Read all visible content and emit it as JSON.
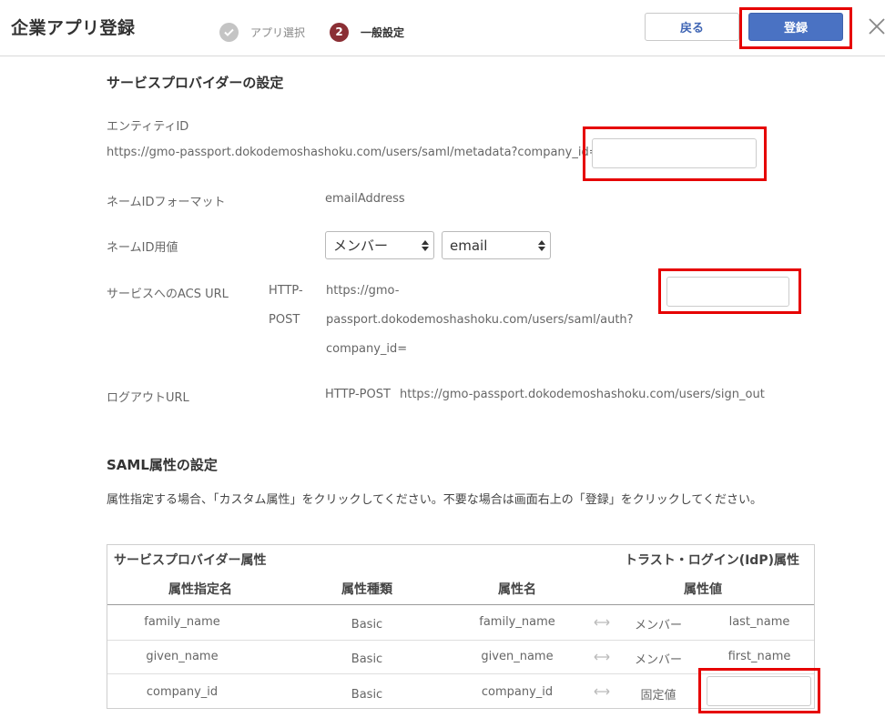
{
  "header": {
    "title": "企業アプリ登録",
    "steps": [
      {
        "label": "アプリ選択",
        "icon": "check-icon"
      },
      {
        "label": "一般設定",
        "number": "2"
      }
    ],
    "back_label": "戻る",
    "register_label": "登録",
    "close_icon": "close-icon"
  },
  "sp_settings": {
    "title": "サービスプロバイダーの設定",
    "entity_id": {
      "label": "エンティティID",
      "url": "https://gmo-passport.dokodemoshashoku.com/users/saml/metadata?company_id=",
      "input_value": ""
    },
    "name_id_format": {
      "label": "ネームIDフォーマット",
      "value": "emailAddress"
    },
    "name_id_value": {
      "label": "ネームID用値",
      "select1": "メンバー",
      "select2": "email"
    },
    "acs_url": {
      "label": "サービスへのACS URL",
      "binding_line1": "HTTP-",
      "binding_line2": "POST",
      "url_line1": "https://gmo-",
      "url_line2": "passport.dokodemoshashoku.com/users/saml/auth?",
      "url_line3": "company_id=",
      "input_value": ""
    },
    "logout_url": {
      "label": "ログアウトURL",
      "binding": "HTTP-POST",
      "url": "https://gmo-passport.dokodemoshashoku.com/users/sign_out"
    }
  },
  "saml_settings": {
    "title": "SAML属性の設定",
    "description": "属性指定する場合、「カスタム属性」をクリックしてください。不要な場合は画面右上の「登録」をクリックしてください。",
    "table": {
      "group_left": "サービスプロバイダー属性",
      "group_right": "トラスト・ログイン(IdP)属性",
      "columns": [
        "属性指定名",
        "属性種類",
        "属性名",
        "属性値"
      ],
      "rows": [
        {
          "attr_name": "family_name",
          "type": "Basic",
          "idp_attr": "family_name",
          "idp_type": "メンバー",
          "value": "last_name"
        },
        {
          "attr_name": "given_name",
          "type": "Basic",
          "idp_attr": "given_name",
          "idp_type": "メンバー",
          "value": "first_name"
        },
        {
          "attr_name": "company_id",
          "type": "Basic",
          "idp_attr": "company_id",
          "idp_type": "固定値",
          "value": ""
        }
      ]
    }
  },
  "colors": {
    "primary": "#4a72c3",
    "highlight": "#e60000",
    "step_active": "#8b2f35"
  }
}
